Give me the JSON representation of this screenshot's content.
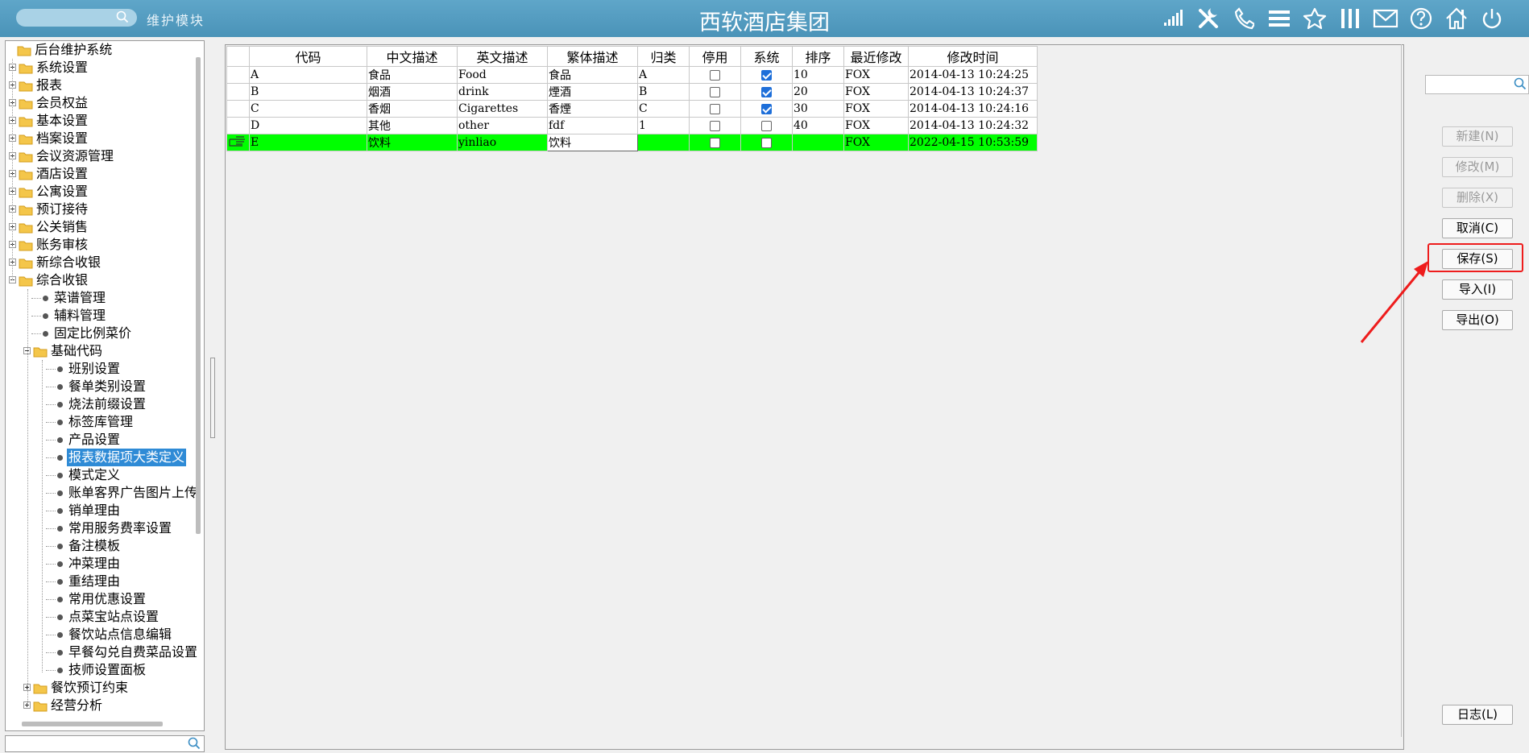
{
  "header": {
    "title": "西软酒店集团",
    "module_label": "维护模块",
    "icons": [
      "signal-icon",
      "tools-icon",
      "phone-icon",
      "menu-icon",
      "star-icon",
      "columns-icon",
      "mail-icon",
      "help-icon",
      "home-icon",
      "power-icon"
    ]
  },
  "tree": {
    "root": "后台维护系统",
    "items": [
      "系统设置",
      "报表",
      "会员权益",
      "基本设置",
      "档案设置",
      "会议资源管理",
      "酒店设置",
      "公寓设置",
      "预订接待",
      "公关销售",
      "账务审核",
      "新综合收银",
      "综合收银"
    ],
    "pos_children": [
      "菜谱管理",
      "辅料管理",
      "固定比例菜价",
      "基础代码"
    ],
    "basic_code_children": [
      "班别设置",
      "餐单类别设置",
      "烧法前缀设置",
      "标签库管理",
      "产品设置",
      "报表数据项大类定义",
      "模式定义",
      "账单客界广告图片上传",
      "销单理由",
      "常用服务费率设置",
      "备注模板",
      "冲菜理由",
      "重结理由",
      "常用优惠设置",
      "点菜宝站点设置",
      "餐饮站点信息编辑",
      "早餐勾兑自费菜品设置",
      "技师设置面板"
    ],
    "pos_tail": [
      "餐饮预订约束",
      "经营分析"
    ],
    "selected": "报表数据项大类定义"
  },
  "grid": {
    "columns": [
      "代码",
      "中文描述",
      "英文描述",
      "繁体描述",
      "归类",
      "停用",
      "系统",
      "排序",
      "最近修改",
      "修改时间"
    ],
    "rows": [
      {
        "code": "A",
        "cn": "食品",
        "en": "Food",
        "tw": "食品",
        "cat": "A",
        "disabled": false,
        "system": true,
        "sort": "10",
        "user": "FOX",
        "time": "2014-04-13 10:24:25"
      },
      {
        "code": "B",
        "cn": "烟酒",
        "en": "drink",
        "tw": "煙酒",
        "cat": "B",
        "disabled": false,
        "system": true,
        "sort": "20",
        "user": "FOX",
        "time": "2014-04-13 10:24:37"
      },
      {
        "code": "C",
        "cn": "香烟",
        "en": "Cigarettes",
        "tw": "香煙",
        "cat": "C",
        "disabled": false,
        "system": true,
        "sort": "30",
        "user": "FOX",
        "time": "2014-04-13 10:24:16"
      },
      {
        "code": "D",
        "cn": "其他",
        "en": "other",
        "tw": "fdf",
        "cat": "1",
        "disabled": false,
        "system": false,
        "sort": "40",
        "user": "FOX",
        "time": "2014-04-13 10:24:32"
      },
      {
        "code": "E",
        "cn": "饮料",
        "en": "yinliao",
        "tw": "饮料",
        "cat": "",
        "disabled": false,
        "system": false,
        "sort": "",
        "user": "FOX",
        "time": "2022-04-15 10:53:59"
      }
    ],
    "active_row": 4
  },
  "actions": {
    "new": "新建(N)",
    "edit": "修改(M)",
    "delete": "删除(X)",
    "cancel": "取消(C)",
    "save": "保存(S)",
    "import": "导入(I)",
    "export": "导出(O)",
    "log": "日志(L)"
  },
  "colors": {
    "header_bg": "#4a93b8",
    "active_row": "#00ff00",
    "selection": "#2f8bd6",
    "highlight": "#ee1c1c",
    "checkbox_on": "#1e6fd9"
  }
}
